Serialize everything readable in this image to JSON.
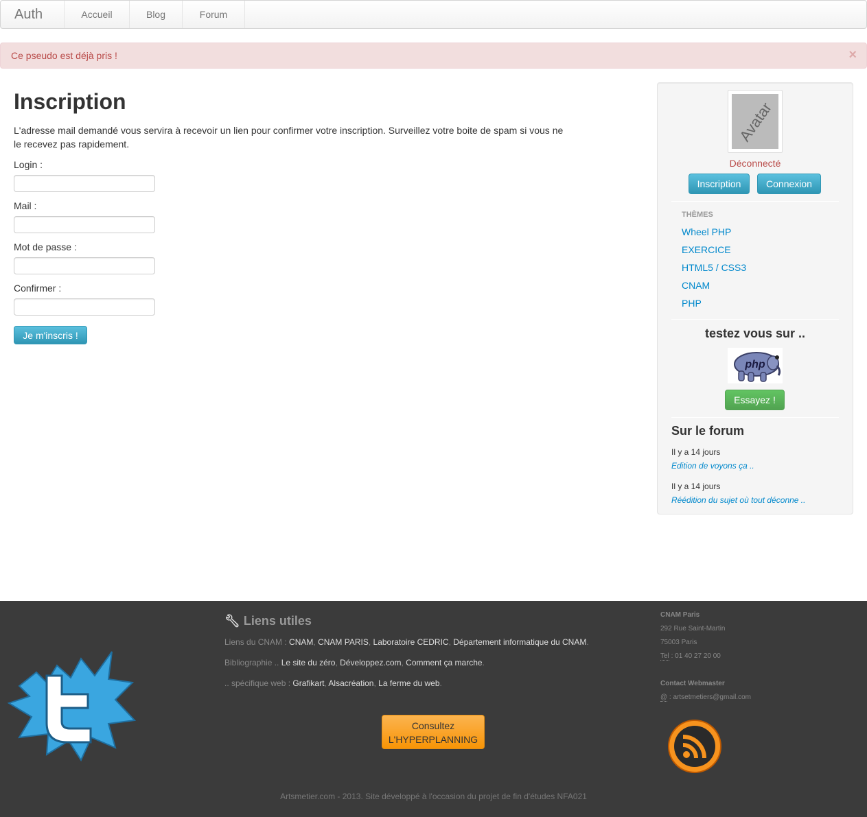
{
  "navbar": {
    "brand": "Auth",
    "items": [
      "Accueil",
      "Blog",
      "Forum"
    ]
  },
  "alert": {
    "message": "Ce pseudo est déjà pris !",
    "close": "×"
  },
  "main": {
    "title": "Inscription",
    "intro": "L'adresse mail demandé vous servira à recevoir un lien pour confirmer votre inscription. Surveillez votre boite de spam si vous ne le recevez pas rapidement.",
    "fields": [
      {
        "label": "Login :",
        "value": ""
      },
      {
        "label": "Mail :",
        "value": ""
      },
      {
        "label": "Mot de passe :",
        "value": ""
      },
      {
        "label": "Confirmer :",
        "value": ""
      }
    ],
    "submit": "Je m'inscris !"
  },
  "sidebar": {
    "avatar": "Avatar",
    "status": "Déconnecté",
    "btn_register": "Inscription",
    "btn_login": "Connexion",
    "themes_header": "THÈMES",
    "themes": [
      "Wheel PHP",
      "EXERCICE",
      "HTML5 / CSS3",
      "CNAM",
      "PHP"
    ],
    "test_title": "testez vous sur ..",
    "php_logo": "php",
    "try_button": "Essayez !",
    "forum_title": "Sur le forum",
    "forum_posts": [
      {
        "date": "Il y a 14 jours",
        "title": "Edition de voyons ça .."
      },
      {
        "date": "Il y a 14 jours",
        "title": "Réédition du sujet où tout déconne .."
      }
    ]
  },
  "footer": {
    "links_title": "Liens utiles",
    "link_rows": [
      {
        "prefix": "Liens du CNAM : ",
        "links": [
          "CNAM",
          "CNAM PARIS",
          "Laboratoire CEDRIC",
          "Département informatique du CNAM"
        ],
        "suffix": "."
      },
      {
        "prefix": "Bibliographie .. ",
        "links": [
          "Le site du zéro",
          "Développez.com",
          "Comment ça marche"
        ],
        "suffix": "."
      },
      {
        "prefix": ".. spécifique web : ",
        "links": [
          "Grafikart",
          "Alsacréation",
          "La ferme du web"
        ],
        "suffix": "."
      }
    ],
    "hyper_line1": "Consultez",
    "hyper_line2": "L'HYPERPLANNING",
    "address_title": "CNAM Paris",
    "address_street": "292 Rue Saint-Martin",
    "address_city": "75003 Paris",
    "tel_label": "Tel",
    "tel": " : 01 40 27 20 00",
    "contact_title": "Contact Webmaster",
    "email_label": "@",
    "email": " : artsetmetiers@gmail.com",
    "copyright": "Artsmetier.com - 2013. Site développé à l'occasion du projet de fin d'études NFA021"
  }
}
